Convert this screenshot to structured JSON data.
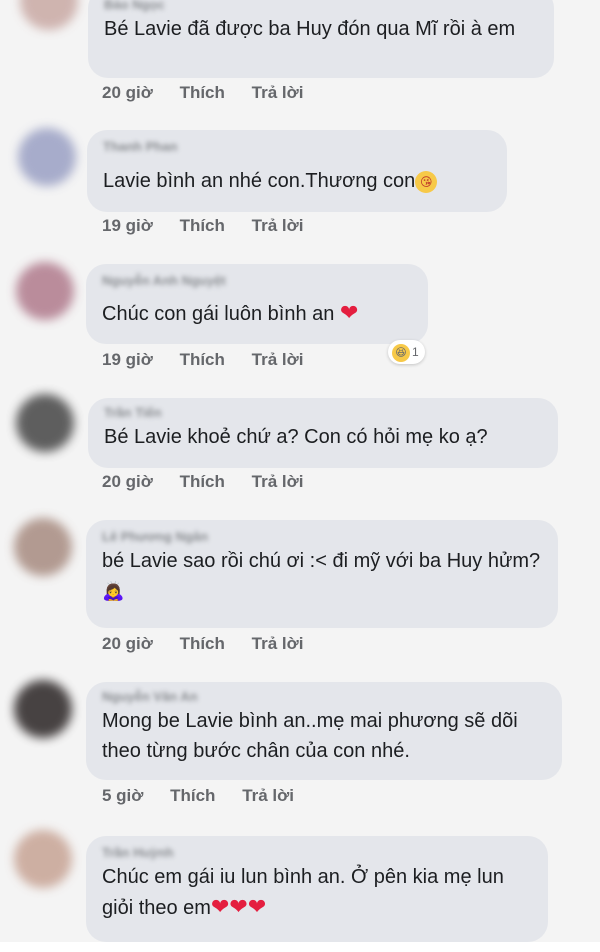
{
  "comments": [
    {
      "name": "Bảo Ngọc",
      "text": "Bé Lavie đã được ba Huy đón qua Mĩ rồi à em",
      "time": "20 giờ",
      "like": "Thích",
      "reply": "Trả lời"
    },
    {
      "name": "Thanh Phan",
      "text": "Lavie bình an nhé con.Thương con",
      "time": "19 giờ",
      "like": "Thích",
      "reply": "Trả lời"
    },
    {
      "name": "Nguyễn Anh Nguyệt",
      "text": "Chúc con gái luôn bình an",
      "time": "19 giờ",
      "like": "Thích",
      "reply": "Trả lời",
      "reaction_count": "1"
    },
    {
      "name": "Trần Tiến",
      "text": "Bé Lavie khoẻ chứ a? Con có hỏi mẹ ko ạ?",
      "time": "20 giờ",
      "like": "Thích",
      "reply": "Trả lời"
    },
    {
      "name": "Lê Phương Ngân",
      "text": "bé Lavie sao rồi chú ơi :< đi mỹ với ba Huy hửm?",
      "time": "20 giờ",
      "like": "Thích",
      "reply": "Trả lời"
    },
    {
      "name": "Nguyễn Văn An",
      "text": "Mong be Lavie bình an..mẹ mai phương sẽ dõi theo từng bước chân của con nhé.",
      "time": "5 giờ",
      "like": "Thích",
      "reply": "Trả lời"
    },
    {
      "name": "Trần Huỳnh",
      "text": "Chúc em gái iu lun bình an. Ở pên kia mẹ lun giỏi theo em",
      "time": "",
      "like": "",
      "reply": ""
    }
  ],
  "colors": {
    "bubble": "#e4e6eb",
    "meta": "#65676b",
    "heart": "#e41e3f"
  },
  "icons": [
    "kissing-face-icon",
    "heart-icon",
    "laughing-face-icon",
    "woman-emoji-icon"
  ]
}
